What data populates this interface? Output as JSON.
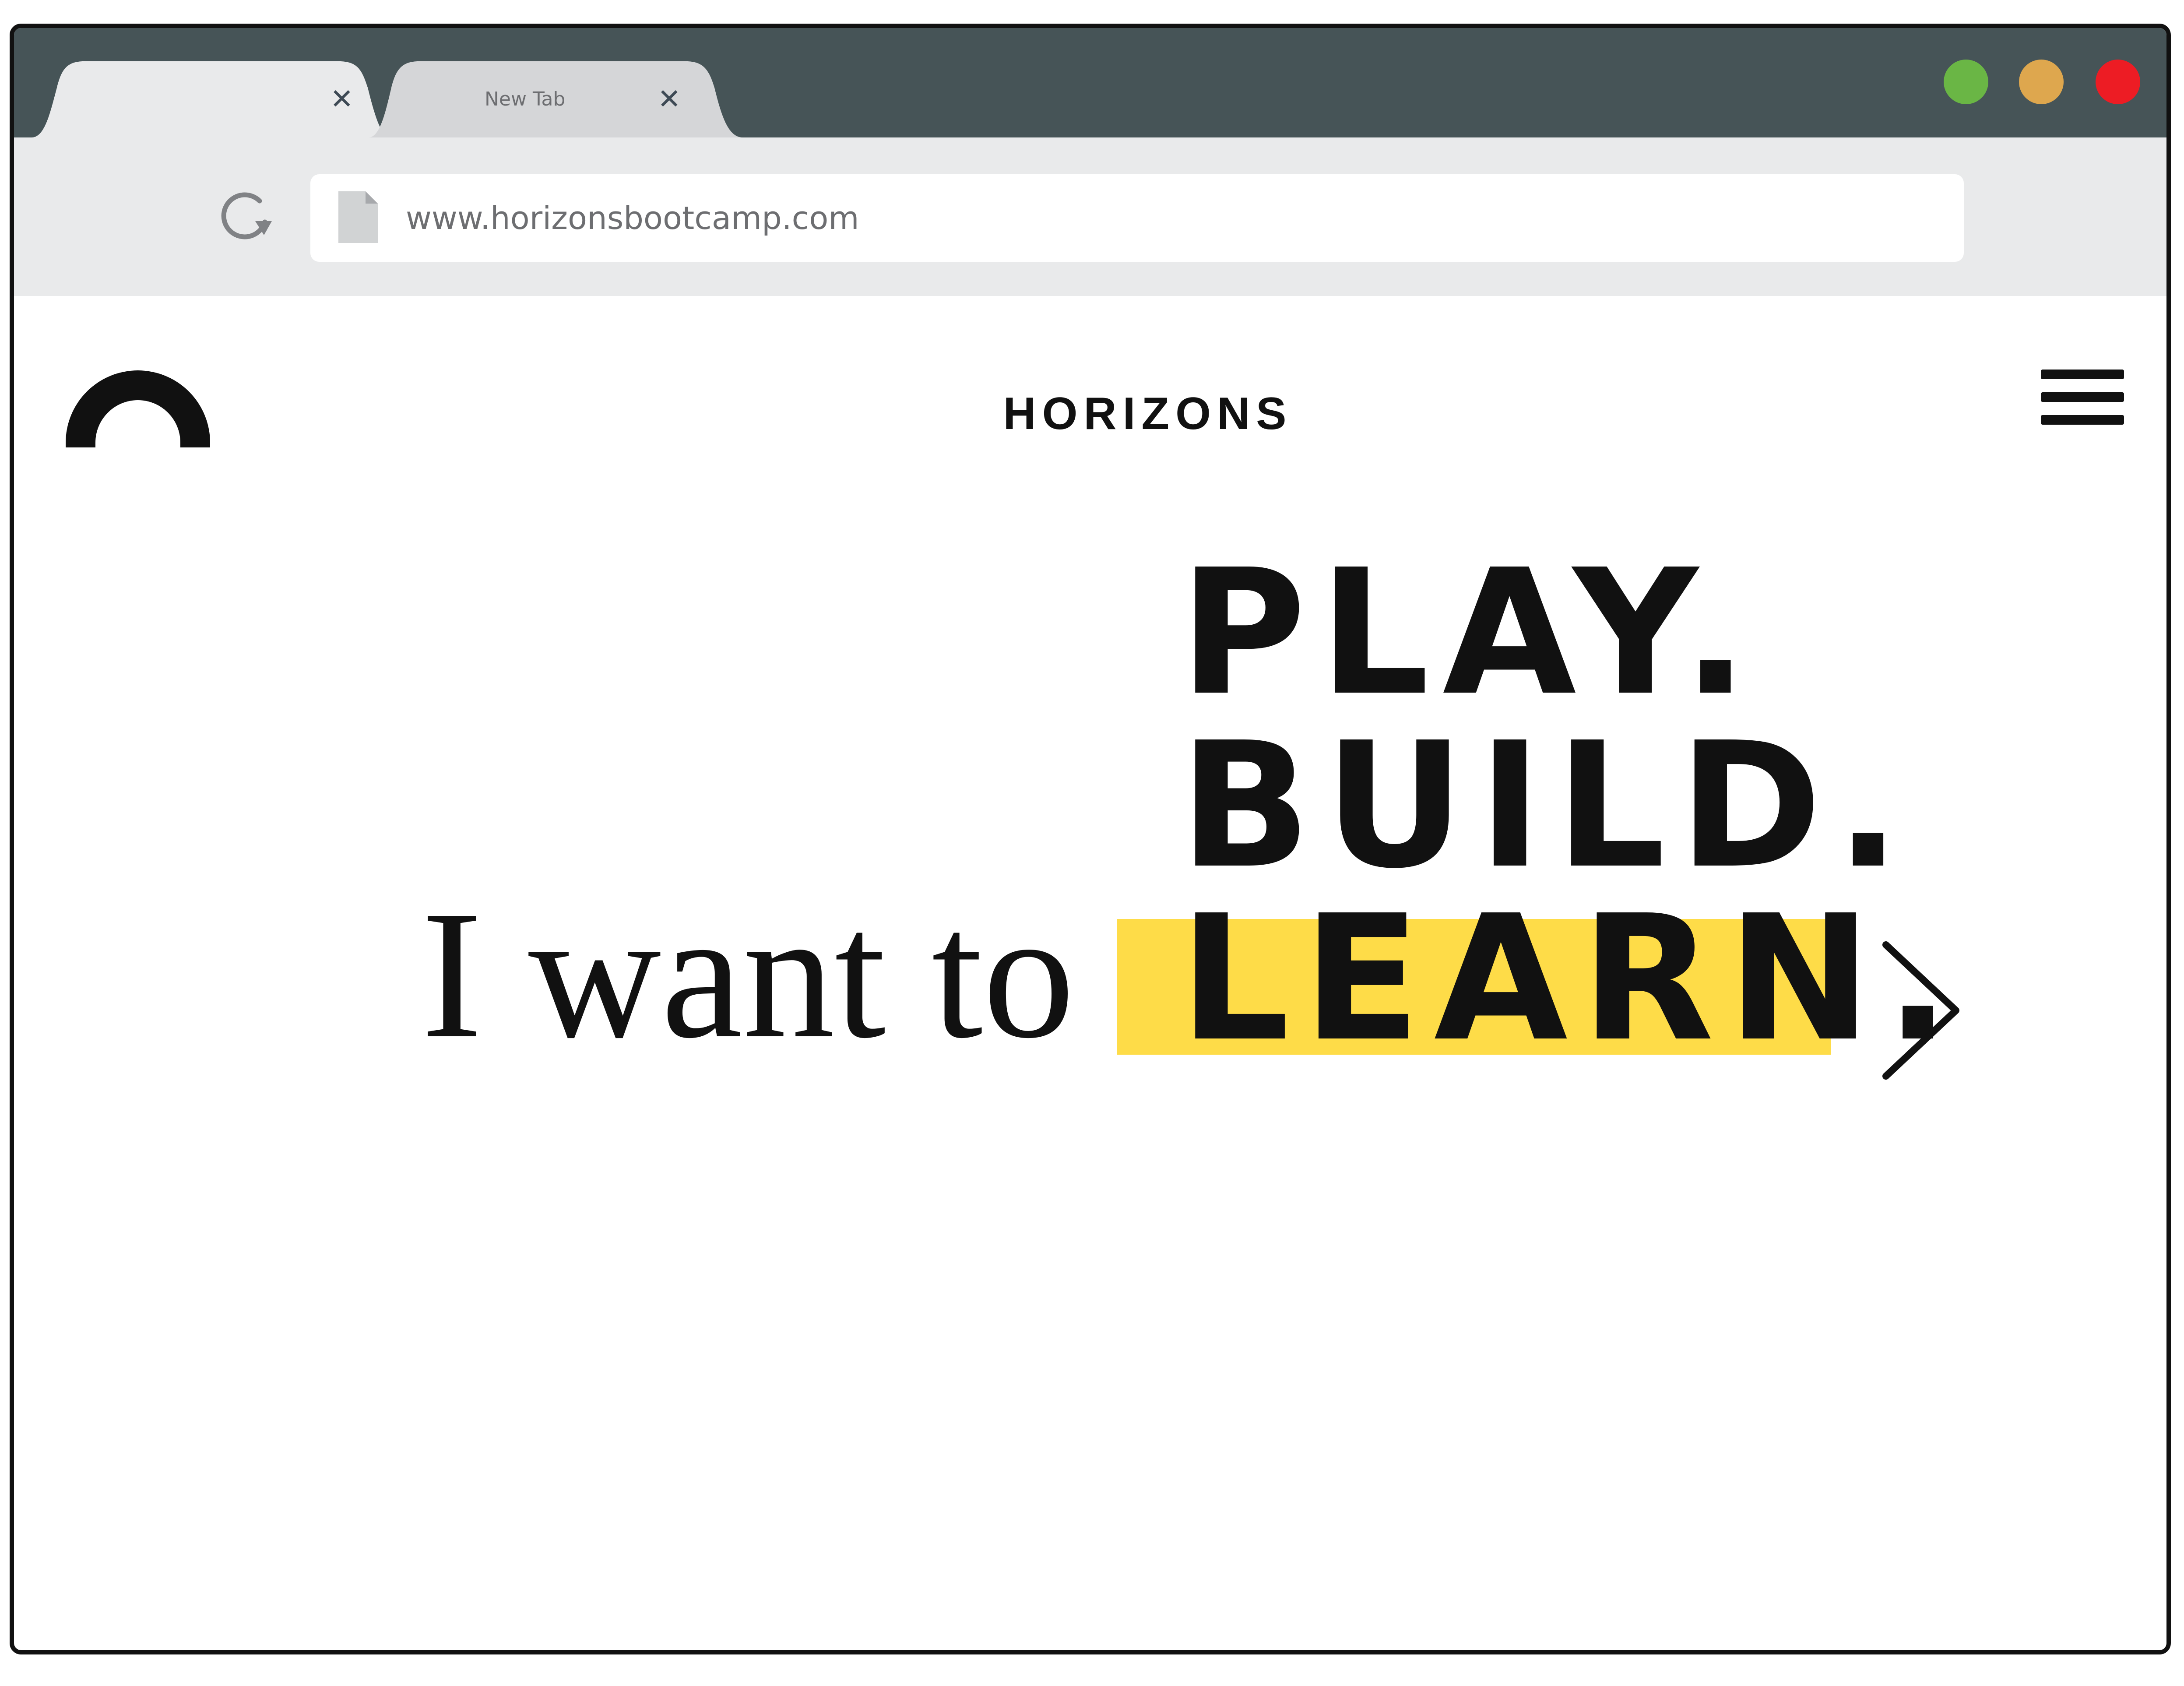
{
  "browser": {
    "tabs": [
      {
        "label": "",
        "close_icon": "close-icon",
        "active": true
      },
      {
        "label": "New Tab",
        "close_icon": "close-icon",
        "active": false
      }
    ],
    "window_controls": {
      "colors": [
        "#6ab645",
        "#dea74e",
        "#ed1c24"
      ]
    },
    "address_bar": {
      "url": "www.horizonsbootcamp.com",
      "icons": [
        "reload-icon",
        "page-icon"
      ]
    }
  },
  "site": {
    "logo_icon": "horizons-arch-logo-icon",
    "brand": "HORIZONS",
    "menu_icon": "hamburger-menu-icon",
    "hero": {
      "prefix": "I want to",
      "words": [
        "PLAY.",
        "BUILD.",
        "LEARN."
      ],
      "highlight_color": "#fedc48",
      "next_icon": "chevron-right-icon"
    }
  }
}
